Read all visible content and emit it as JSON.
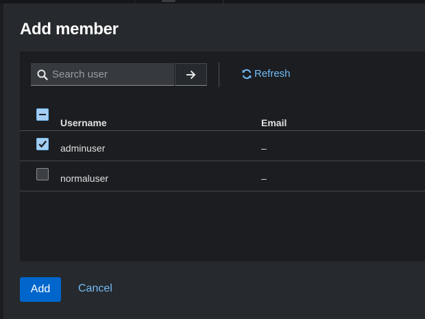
{
  "dialog": {
    "title": "Add member"
  },
  "toolbar": {
    "search_placeholder": "Search user",
    "refresh_label": "Refresh"
  },
  "table": {
    "headers": {
      "username": "Username",
      "email": "Email"
    },
    "rows": [
      {
        "username": "adminuser",
        "email": "–",
        "checked": true
      },
      {
        "username": "normaluser",
        "email": "–",
        "checked": false
      }
    ]
  },
  "footer": {
    "add_label": "Add",
    "cancel_label": "Cancel"
  },
  "colors": {
    "accent": "#0066cc",
    "link": "#73bcf7",
    "modal_bg": "#26292d",
    "panel_bg": "#1b1d21"
  }
}
